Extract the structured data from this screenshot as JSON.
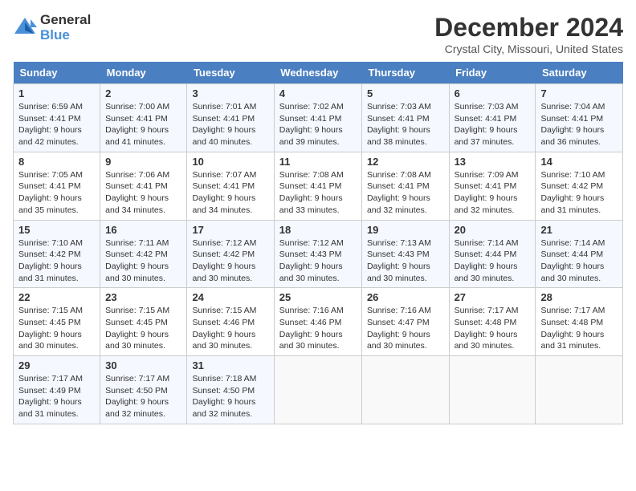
{
  "logo": {
    "line1": "General",
    "line2": "Blue"
  },
  "title": "December 2024",
  "location": "Crystal City, Missouri, United States",
  "weekdays": [
    "Sunday",
    "Monday",
    "Tuesday",
    "Wednesday",
    "Thursday",
    "Friday",
    "Saturday"
  ],
  "weeks": [
    [
      {
        "day": "1",
        "info": "Sunrise: 6:59 AM\nSunset: 4:41 PM\nDaylight: 9 hours\nand 42 minutes."
      },
      {
        "day": "2",
        "info": "Sunrise: 7:00 AM\nSunset: 4:41 PM\nDaylight: 9 hours\nand 41 minutes."
      },
      {
        "day": "3",
        "info": "Sunrise: 7:01 AM\nSunset: 4:41 PM\nDaylight: 9 hours\nand 40 minutes."
      },
      {
        "day": "4",
        "info": "Sunrise: 7:02 AM\nSunset: 4:41 PM\nDaylight: 9 hours\nand 39 minutes."
      },
      {
        "day": "5",
        "info": "Sunrise: 7:03 AM\nSunset: 4:41 PM\nDaylight: 9 hours\nand 38 minutes."
      },
      {
        "day": "6",
        "info": "Sunrise: 7:03 AM\nSunset: 4:41 PM\nDaylight: 9 hours\nand 37 minutes."
      },
      {
        "day": "7",
        "info": "Sunrise: 7:04 AM\nSunset: 4:41 PM\nDaylight: 9 hours\nand 36 minutes."
      }
    ],
    [
      {
        "day": "8",
        "info": "Sunrise: 7:05 AM\nSunset: 4:41 PM\nDaylight: 9 hours\nand 35 minutes."
      },
      {
        "day": "9",
        "info": "Sunrise: 7:06 AM\nSunset: 4:41 PM\nDaylight: 9 hours\nand 34 minutes."
      },
      {
        "day": "10",
        "info": "Sunrise: 7:07 AM\nSunset: 4:41 PM\nDaylight: 9 hours\nand 34 minutes."
      },
      {
        "day": "11",
        "info": "Sunrise: 7:08 AM\nSunset: 4:41 PM\nDaylight: 9 hours\nand 33 minutes."
      },
      {
        "day": "12",
        "info": "Sunrise: 7:08 AM\nSunset: 4:41 PM\nDaylight: 9 hours\nand 32 minutes."
      },
      {
        "day": "13",
        "info": "Sunrise: 7:09 AM\nSunset: 4:41 PM\nDaylight: 9 hours\nand 32 minutes."
      },
      {
        "day": "14",
        "info": "Sunrise: 7:10 AM\nSunset: 4:42 PM\nDaylight: 9 hours\nand 31 minutes."
      }
    ],
    [
      {
        "day": "15",
        "info": "Sunrise: 7:10 AM\nSunset: 4:42 PM\nDaylight: 9 hours\nand 31 minutes."
      },
      {
        "day": "16",
        "info": "Sunrise: 7:11 AM\nSunset: 4:42 PM\nDaylight: 9 hours\nand 30 minutes."
      },
      {
        "day": "17",
        "info": "Sunrise: 7:12 AM\nSunset: 4:42 PM\nDaylight: 9 hours\nand 30 minutes."
      },
      {
        "day": "18",
        "info": "Sunrise: 7:12 AM\nSunset: 4:43 PM\nDaylight: 9 hours\nand 30 minutes."
      },
      {
        "day": "19",
        "info": "Sunrise: 7:13 AM\nSunset: 4:43 PM\nDaylight: 9 hours\nand 30 minutes."
      },
      {
        "day": "20",
        "info": "Sunrise: 7:14 AM\nSunset: 4:44 PM\nDaylight: 9 hours\nand 30 minutes."
      },
      {
        "day": "21",
        "info": "Sunrise: 7:14 AM\nSunset: 4:44 PM\nDaylight: 9 hours\nand 30 minutes."
      }
    ],
    [
      {
        "day": "22",
        "info": "Sunrise: 7:15 AM\nSunset: 4:45 PM\nDaylight: 9 hours\nand 30 minutes."
      },
      {
        "day": "23",
        "info": "Sunrise: 7:15 AM\nSunset: 4:45 PM\nDaylight: 9 hours\nand 30 minutes."
      },
      {
        "day": "24",
        "info": "Sunrise: 7:15 AM\nSunset: 4:46 PM\nDaylight: 9 hours\nand 30 minutes."
      },
      {
        "day": "25",
        "info": "Sunrise: 7:16 AM\nSunset: 4:46 PM\nDaylight: 9 hours\nand 30 minutes."
      },
      {
        "day": "26",
        "info": "Sunrise: 7:16 AM\nSunset: 4:47 PM\nDaylight: 9 hours\nand 30 minutes."
      },
      {
        "day": "27",
        "info": "Sunrise: 7:17 AM\nSunset: 4:48 PM\nDaylight: 9 hours\nand 30 minutes."
      },
      {
        "day": "28",
        "info": "Sunrise: 7:17 AM\nSunset: 4:48 PM\nDaylight: 9 hours\nand 31 minutes."
      }
    ],
    [
      {
        "day": "29",
        "info": "Sunrise: 7:17 AM\nSunset: 4:49 PM\nDaylight: 9 hours\nand 31 minutes."
      },
      {
        "day": "30",
        "info": "Sunrise: 7:17 AM\nSunset: 4:50 PM\nDaylight: 9 hours\nand 32 minutes."
      },
      {
        "day": "31",
        "info": "Sunrise: 7:18 AM\nSunset: 4:50 PM\nDaylight: 9 hours\nand 32 minutes."
      },
      {
        "day": "",
        "info": ""
      },
      {
        "day": "",
        "info": ""
      },
      {
        "day": "",
        "info": ""
      },
      {
        "day": "",
        "info": ""
      }
    ]
  ]
}
